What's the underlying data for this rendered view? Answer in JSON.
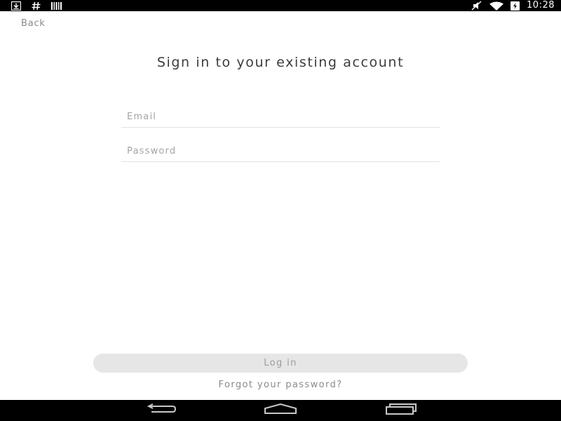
{
  "status_bar": {
    "time": "10:28",
    "left_icons": [
      "download-icon",
      "hash-icon",
      "barcode-icon"
    ],
    "right_icons": [
      "mute-icon",
      "wifi-icon",
      "battery-charging-icon"
    ]
  },
  "header": {
    "back_label": "Back"
  },
  "main": {
    "title": "Sign in to your existing account",
    "email_placeholder": "Email",
    "password_placeholder": "Password",
    "login_label": "Log in",
    "forgot_label": "Forgot your password?"
  },
  "nav_bar": {
    "buttons": [
      "back-icon",
      "home-icon",
      "recents-icon"
    ]
  },
  "colors": {
    "status_bar_bg": "#000000",
    "title_text": "#3c3c3c",
    "muted_text": "#8a8a8a",
    "button_bg": "#e6e6e6",
    "divider": "#e3e3e3"
  }
}
